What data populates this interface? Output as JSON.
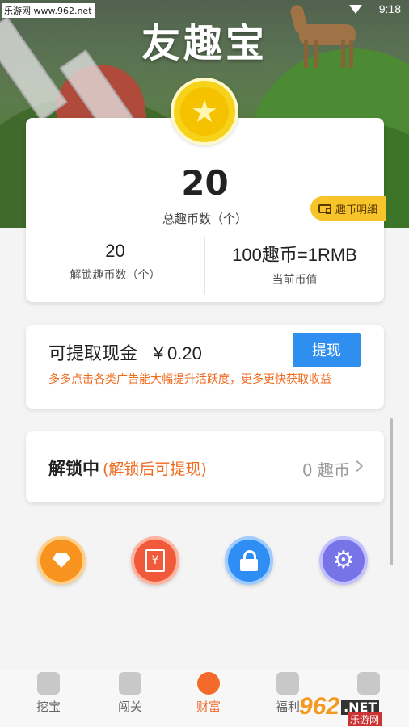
{
  "status_bar": {
    "watermark": "乐游网 www.962.net",
    "time": "9:18"
  },
  "app": {
    "title": "友趣宝"
  },
  "coin_card": {
    "total_value": "20",
    "total_label": "总趣币数（个）",
    "detail_badge": "趣币明细",
    "unlocked_value": "20",
    "unlocked_label": "解锁趣币数（个）",
    "rate_value": "100趣币=1RMB",
    "rate_label": "当前币值"
  },
  "cash_card": {
    "label": "可提取现金",
    "amount": "￥0.20",
    "withdraw_button": "提现",
    "tip": "多多点击各类广告能大幅提升活跃度，更多更快获取收益"
  },
  "unlock_card": {
    "title": "解锁中",
    "note": "(解锁后可提现)",
    "value": "0 趣币"
  },
  "quick_actions": [
    {
      "icon": "diamond-icon",
      "color": "#f7931e"
    },
    {
      "icon": "yen-card-icon",
      "color": "#f05a3a",
      "glyph": "¥"
    },
    {
      "icon": "lock-icon",
      "color": "#2e8ef4"
    },
    {
      "icon": "gear-icon",
      "color": "#7774e8",
      "glyph": "⚙"
    }
  ],
  "bottom_nav": [
    {
      "label": "挖宝",
      "icon": "monkey-icon",
      "active": false
    },
    {
      "label": "闯关",
      "icon": "chart-icon",
      "active": false
    },
    {
      "label": "财富",
      "icon": "wealth-icon",
      "active": true
    },
    {
      "label": "福利",
      "icon": "gift-icon",
      "active": false
    },
    {
      "label": "",
      "icon": "profile-icon",
      "active": false
    }
  ],
  "watermark_bottom": {
    "logo": "962",
    "net": ".NET",
    "cn": "乐游网"
  },
  "colors": {
    "accent_orange": "#f06a1c",
    "button_blue": "#2f8ff0",
    "badge_yellow": "#f7c42a"
  }
}
